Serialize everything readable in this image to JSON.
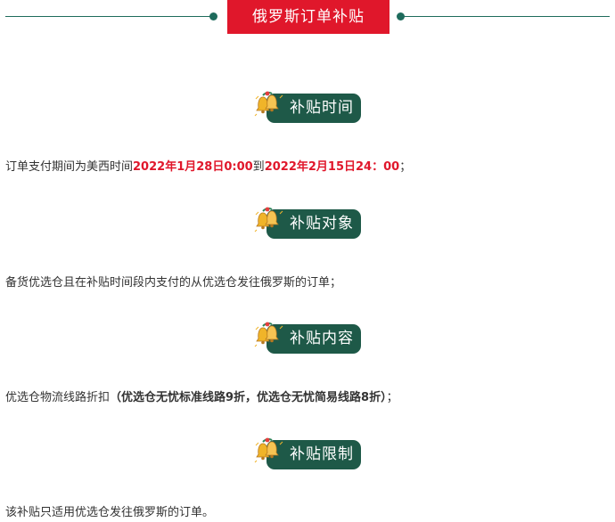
{
  "header": {
    "title": "俄罗斯订单补贴"
  },
  "sections": [
    {
      "title": "补贴时间",
      "text_before": "订单支付期间为美西时间",
      "highlight_start": "2022年1月28日0:00",
      "connector": "到",
      "highlight_end": "2022年2月15日24：00",
      "text_after": "；"
    },
    {
      "title": "补贴对象",
      "text": "备货优选仓且在补贴时间段内支付的从优选仓发往俄罗斯的订单；"
    },
    {
      "title": "补贴内容",
      "text_before": "优选仓物流线路折扣",
      "bold_text": "（优选仓无忧标准线路9折，优选仓无忧简易线路8折）",
      "text_after": "；"
    },
    {
      "title": "补贴限制",
      "text": "该补贴只适用优选仓发往俄罗斯的订单。"
    }
  ],
  "colors": {
    "banner_red": "#e0172b",
    "badge_green": "#1e5948",
    "line_teal": "#1e6b5c",
    "highlight_red": "#e0172b",
    "text": "#333333"
  },
  "icons": {
    "section_icon": "christmas-bells-icon"
  }
}
